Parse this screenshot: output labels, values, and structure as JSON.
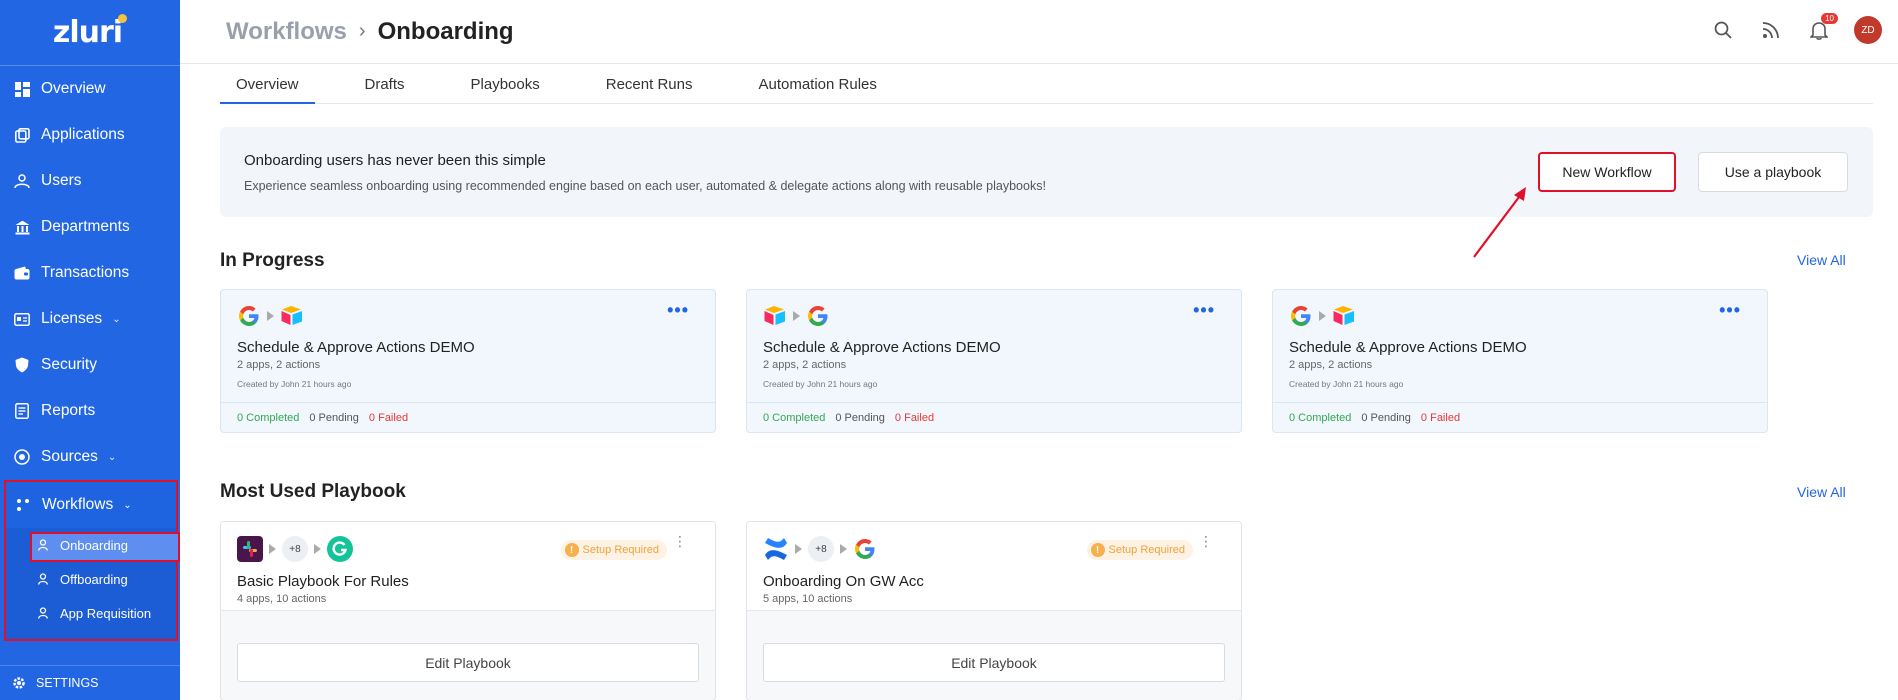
{
  "brand": {
    "logo_text": "zluri"
  },
  "sidebar": {
    "items": [
      {
        "label": "Overview",
        "icon": "grid-icon"
      },
      {
        "label": "Applications",
        "icon": "apps-icon"
      },
      {
        "label": "Users",
        "icon": "users-icon"
      },
      {
        "label": "Departments",
        "icon": "building-icon"
      },
      {
        "label": "Transactions",
        "icon": "wallet-icon"
      },
      {
        "label": "Licenses",
        "icon": "license-icon"
      },
      {
        "label": "Security",
        "icon": "shield-icon"
      },
      {
        "label": "Reports",
        "icon": "report-icon"
      },
      {
        "label": "Sources",
        "icon": "sources-icon"
      }
    ],
    "workflows": {
      "label": "Workflows",
      "sub": [
        {
          "label": "Onboarding",
          "active": true
        },
        {
          "label": "Offboarding"
        },
        {
          "label": "App Requisition"
        }
      ]
    },
    "settings_label": "SETTINGS"
  },
  "header": {
    "breadcrumb_root": "Workflows",
    "breadcrumb_sep": "›",
    "breadcrumb_current": "Onboarding",
    "notification_count": "10",
    "avatar_initials": "ZD"
  },
  "tabs": [
    "Overview",
    "Drafts",
    "Playbooks",
    "Recent Runs",
    "Automation Rules"
  ],
  "banner": {
    "title": "Onboarding users has never been this simple",
    "subtitle": "Experience seamless onboarding using recommended engine based on each user, automated & delegate actions along with reusable playbooks!",
    "new_workflow": "New Workflow",
    "use_playbook": "Use a playbook"
  },
  "in_progress": {
    "title": "In Progress",
    "view_all": "View All",
    "cards": [
      {
        "name": "Schedule & Approve Actions DEMO",
        "meta": "2 apps, 2 actions",
        "creator": "Created by John 21 hours ago",
        "completed": "0 Completed",
        "pending": "0 Pending",
        "failed": "0 Failed"
      },
      {
        "name": "Schedule & Approve Actions DEMO",
        "meta": "2 apps, 2 actions",
        "creator": "Created by John 21 hours ago",
        "completed": "0 Completed",
        "pending": "0 Pending",
        "failed": "0 Failed"
      },
      {
        "name": "Schedule & Approve Actions DEMO",
        "meta": "2 apps, 2 actions",
        "creator": "Created by John 21 hours ago",
        "completed": "0 Completed",
        "pending": "0 Pending",
        "failed": "0 Failed"
      }
    ]
  },
  "most_used": {
    "title": "Most Used Playbook",
    "view_all": "View All",
    "cards": [
      {
        "name": "Basic Playbook For Rules",
        "meta": "4 apps, 10 actions",
        "extra": "+8",
        "setup": "Setup Required",
        "edit": "Edit Playbook"
      },
      {
        "name": "Onboarding On GW Acc",
        "meta": "5 apps, 10 actions",
        "extra": "+8",
        "setup": "Setup Required",
        "edit": "Edit Playbook"
      }
    ]
  },
  "colors": {
    "accent": "#2266e3",
    "highlight": "#e0102a",
    "success": "#34a853",
    "danger": "#e53935",
    "warning": "#f0a33a"
  }
}
